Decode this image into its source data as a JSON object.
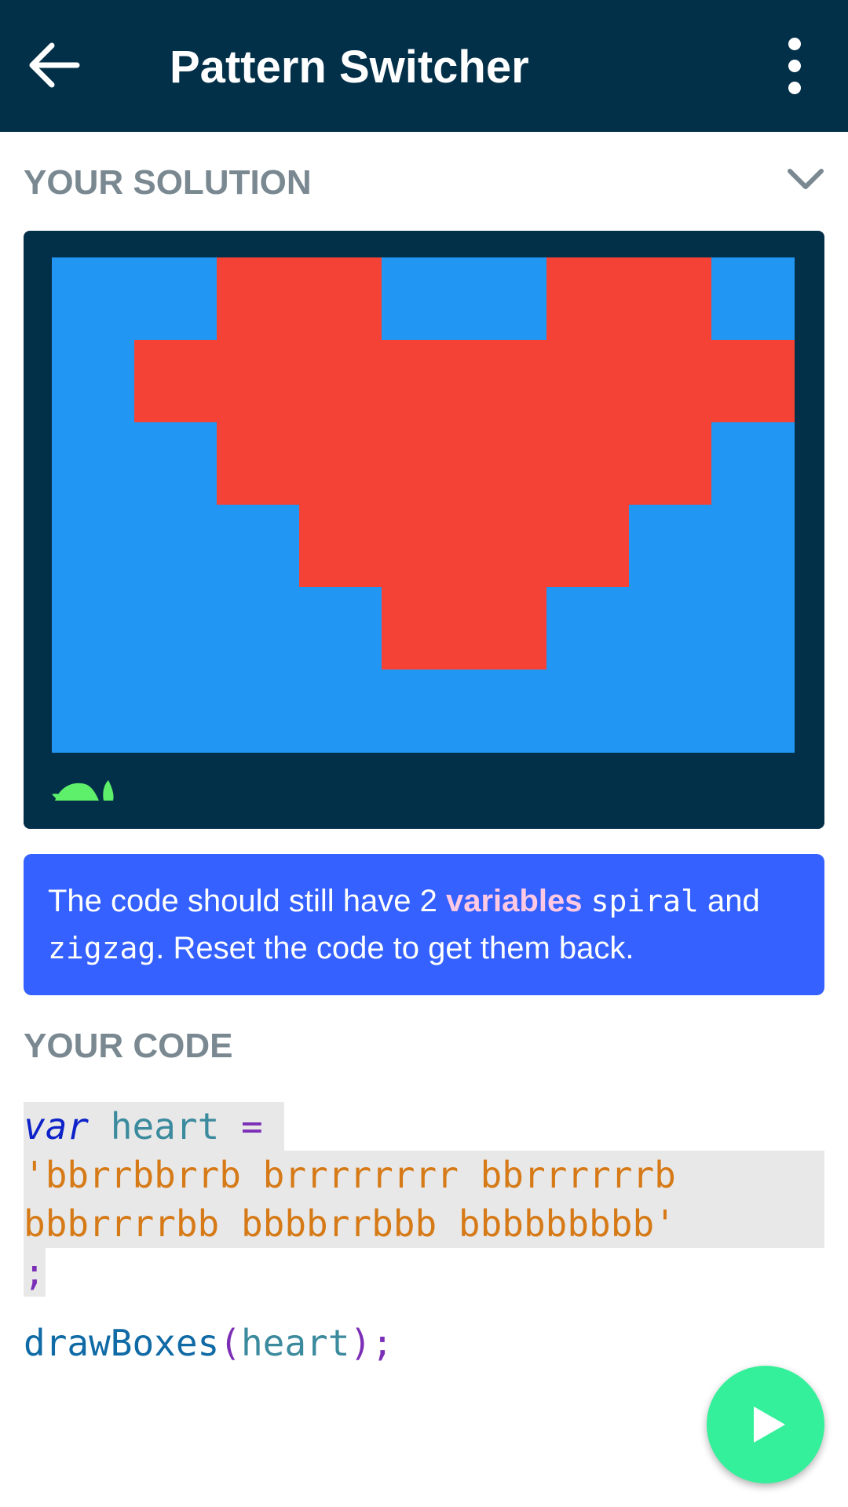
{
  "app_bar": {
    "title": "Pattern Switcher",
    "back_icon": "arrow-left-icon",
    "more_icon": "more-vertical-icon",
    "background": "#033049"
  },
  "solution": {
    "label": "YOUR SOLUTION",
    "collapse_icon": "chevron-down-icon",
    "grid": {
      "rows": [
        "bbrrbbrrb",
        "brrrrrrrr",
        "bbrrrrrrb",
        "bbbrrrrbb",
        "bbbbrrbbb",
        "bbbbbbbbb"
      ],
      "colors": {
        "b": "#2196f3",
        "r": "#f44336"
      }
    },
    "turtle_icon": "turtle-icon"
  },
  "hint": {
    "part1": "The code should still have 2 ",
    "keyword": "variables",
    "space1": " ",
    "var1": "spiral",
    "part2": " and ",
    "var2": "zigzag",
    "part3": ". Reset the code to get them back."
  },
  "code_section": {
    "label": "YOUR CODE",
    "line1": {
      "kw": "var",
      "sp": " ",
      "id": "heart",
      "op": " = "
    },
    "string_line1": "'bbrrbbrrb brrrrrrrr bbrrrrrrb",
    "string_line2": "bbbrrrrbb bbbbrrbbb bbbbbbbbb'",
    "semicolon": ";",
    "call": {
      "fn": "drawBoxes",
      "open": "(",
      "arg": "heart",
      "close": ");"
    }
  },
  "play_button": {
    "icon": "play-icon",
    "color": "#35f09a"
  }
}
